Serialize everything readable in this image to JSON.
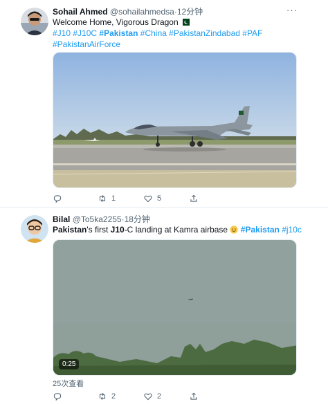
{
  "tweets": [
    {
      "name": "Sohail Ahmed",
      "handle": "@sohailahmedsa",
      "dot": "·",
      "time": "12分钟",
      "text_line1": "Welcome Home, Vigorous Dragon",
      "flag": "🇵🇰",
      "tags_line2": [
        "#J10",
        "#J10C",
        "#Pakistan",
        "#China",
        "#PakistanZindabad",
        "#PAF"
      ],
      "tags_line3": [
        "#PakistanAirForce"
      ],
      "reply_count": "",
      "retweet_count": "1",
      "like_count": "5",
      "icons": [
        "reply-icon",
        "retweet-icon",
        "like-icon",
        "share-icon",
        "more-icon"
      ]
    },
    {
      "name": "Bilal",
      "handle": "@To5ka2255",
      "dot": "·",
      "time": "18分钟",
      "text_part1": "Pakistan",
      "text_part2": "'s first ",
      "text_part3": "J10",
      "text_part4": "-C landing at Kamra airbase",
      "emoji": "😊",
      "tag1": "#Pakistan",
      "tag2": "#j10c",
      "video_duration": "0:25",
      "views": "25次查看",
      "reply_count": "",
      "retweet_count": "2",
      "like_count": "2",
      "icons": [
        "reply-icon",
        "retweet-icon",
        "like-icon",
        "share-icon",
        "more-icon"
      ]
    }
  ],
  "colors": {
    "link": "#1d9bf0",
    "muted": "#536471",
    "text": "#0f1419",
    "sky": "#a9c4e4",
    "haze": "#8f9f9a"
  }
}
